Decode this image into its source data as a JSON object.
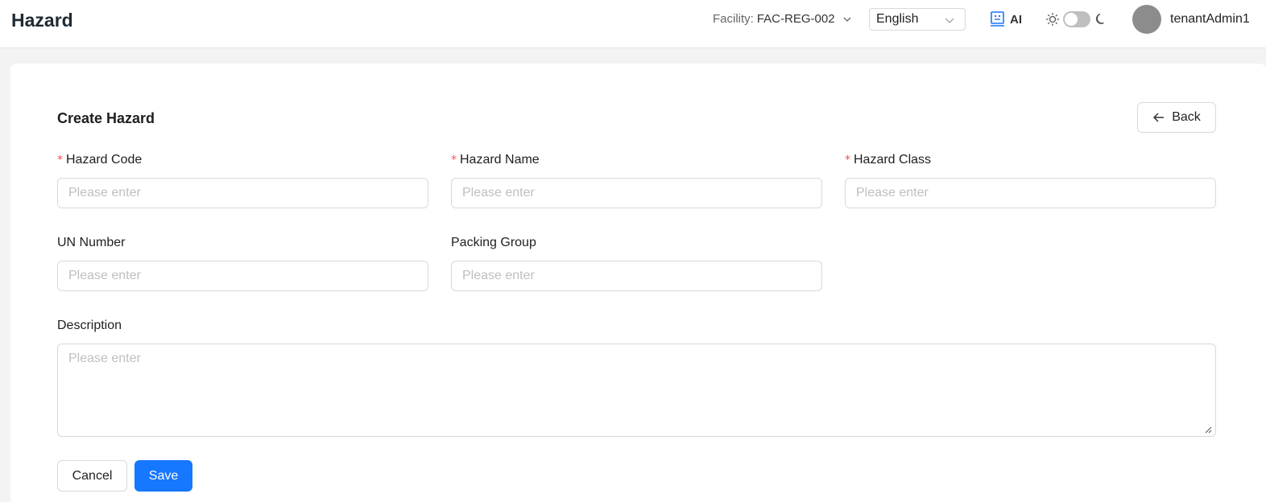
{
  "header": {
    "title": "Hazard",
    "facility_label": "Facility:",
    "facility_value": "FAC-REG-002",
    "language": "English",
    "ai_label": "AI",
    "username": "tenantAdmin1"
  },
  "form": {
    "title": "Create Hazard",
    "back_label": "Back",
    "fields": {
      "hazard_code": {
        "label": "Hazard Code",
        "required": true,
        "value": "",
        "placeholder": "Please enter"
      },
      "hazard_name": {
        "label": "Hazard Name",
        "required": true,
        "value": "",
        "placeholder": "Please enter"
      },
      "hazard_class": {
        "label": "Hazard Class",
        "required": true,
        "value": "",
        "placeholder": "Please enter"
      },
      "un_number": {
        "label": "UN Number",
        "required": false,
        "value": "",
        "placeholder": "Please enter"
      },
      "packing_group": {
        "label": "Packing Group",
        "required": false,
        "value": "",
        "placeholder": "Please enter"
      },
      "description": {
        "label": "Description",
        "required": false,
        "value": "",
        "placeholder": "Please enter"
      }
    },
    "required_mark": "*",
    "cancel_label": "Cancel",
    "save_label": "Save"
  },
  "colors": {
    "primary": "#1677ff",
    "required": "#ff4d4f",
    "background": "#f3f3f3"
  },
  "icons": {
    "facility_dropdown": "chevron-down-icon",
    "language_dropdown": "chevron-down-icon",
    "ai": "robot-icon",
    "theme_light": "sun-icon",
    "theme_dark": "moon-icon",
    "back": "arrow-left-icon"
  }
}
